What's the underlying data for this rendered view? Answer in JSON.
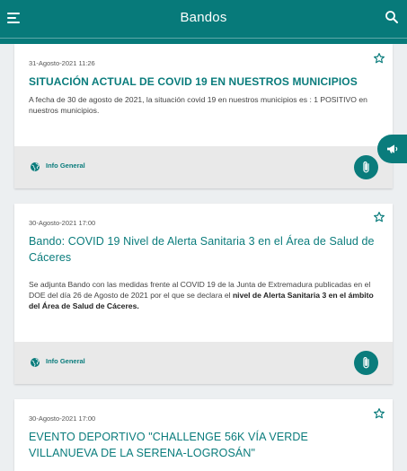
{
  "appbar": {
    "title": "Bandos"
  },
  "posts": [
    {
      "date": "31-Agosto-2021 11:26",
      "title": "SITUACIÓN ACTUAL DE COVID 19 EN NUESTROS MUNICIPIOS",
      "body_plain": "A fecha de 30 de agosto de 2021, la situación covid 19 en nuestros municipios es : 1 POSITIVO en nuestros municipios.",
      "category": "Info General"
    },
    {
      "date": "30-Agosto-2021 17:00",
      "title": "Bando:  COVID 19 Nivel de Alerta Sanitaria 3 en el Área de Salud de Cáceres",
      "body_plain": "Se adjunta Bando con las medidas frente al COVID 19 de la Junta de Extremadura publicadas en el DOE del día 26 de Agosto de 2021 por el que se declara el ",
      "body_bold": "nivel de Alerta Sanitaria 3 en el ámbito del Área de Salud de Cáceres.",
      "category": "Info General"
    },
    {
      "date": "30-Agosto-2021 17:00",
      "title": "EVENTO DEPORTIVO \"CHALLENGE 56K VÍA VERDE VILLANUEVA DE LA SERENA-LOGROSÁN\""
    }
  ],
  "colors": {
    "primary": "#077a7a",
    "accent": "#0a7c7c",
    "footer": "#e9e9e9"
  },
  "icons": {
    "menu": "menu-icon",
    "search": "search-icon",
    "star": "star-outline-icon",
    "globe": "globe-icon",
    "attachment": "paperclip-icon",
    "fab": "megaphone-icon"
  }
}
